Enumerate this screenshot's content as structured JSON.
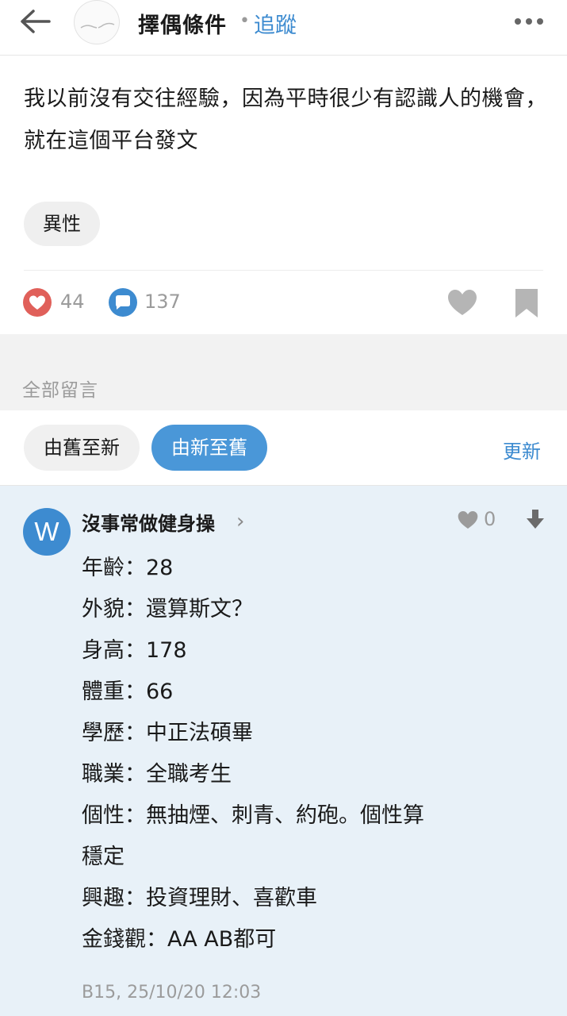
{
  "header": {
    "board_title": "擇偶條件",
    "separator": "•",
    "follow_label": "追蹤"
  },
  "post": {
    "body": "我以前沒有交往經驗，因為平時很少有認識人的機會，就在這個平台發文",
    "topic": "異性",
    "like_count": "44",
    "comment_count": "137"
  },
  "comments_section": {
    "title": "全部留言",
    "sort_oldest": "由舊至新",
    "sort_newest": "由新至舊",
    "refresh": "更新"
  },
  "comment": {
    "avatar_letter": "W",
    "author": "沒事常做健身操",
    "like_count": "0",
    "lines": [
      "年齡：28",
      "外貌：還算斯文？",
      "身高：178",
      "體重：66",
      "學歷：中正法碩畢",
      "職業：全職考生",
      "個性：無抽煙、刺青、約砲。個性算",
      "穩定",
      "興趣：投資理財、喜歡車",
      "金錢觀：AA AB都可"
    ],
    "meta": "B15, 25/10/20 12:03"
  },
  "colors": {
    "accent": "#3d8bd0",
    "like_red": "#e0605a",
    "comment_bg": "#e8f1f8"
  },
  "icons": {
    "back": "back-arrow-icon",
    "more": "more-dots-icon",
    "like": "heart-filled-red-icon",
    "comment": "comment-bubble-icon",
    "favorite": "heart-outline-gray-icon",
    "bookmark": "bookmark-icon",
    "chevron": "chevron-right-icon",
    "down": "arrow-down-icon"
  }
}
